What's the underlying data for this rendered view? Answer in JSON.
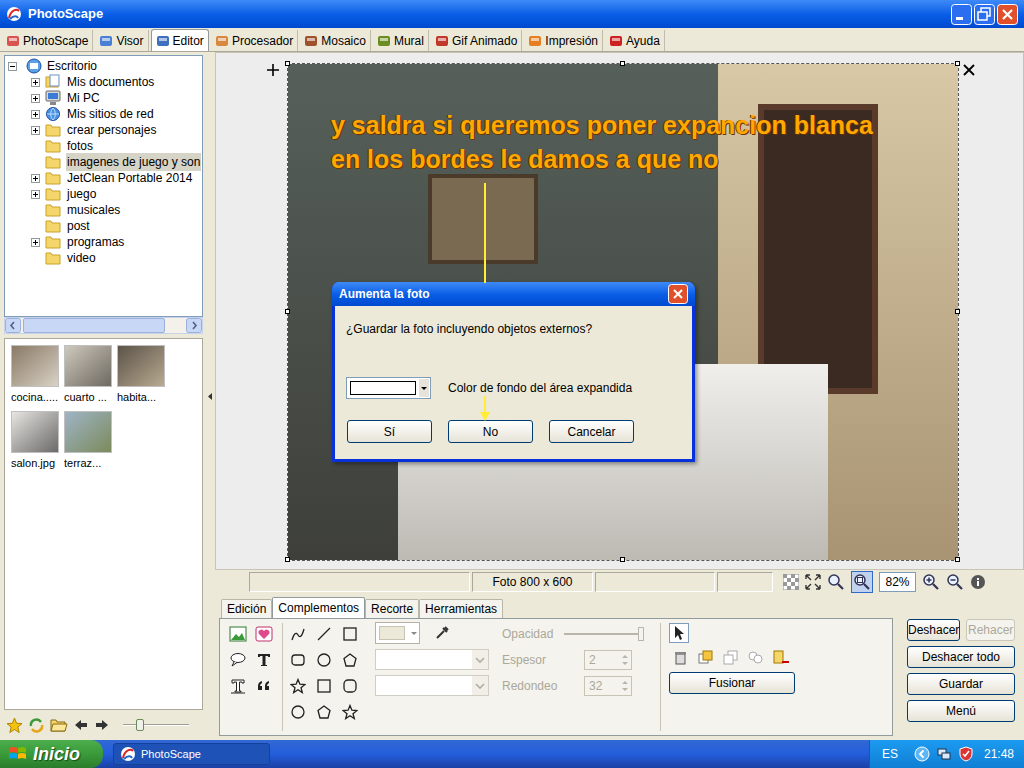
{
  "window": {
    "title": "PhotoScape"
  },
  "tabs": [
    {
      "label": "PhotoScape",
      "selected": false
    },
    {
      "label": "Visor",
      "selected": false
    },
    {
      "label": "Editor",
      "selected": true
    },
    {
      "label": "Procesador",
      "selected": false
    },
    {
      "label": "Mosaico",
      "selected": false
    },
    {
      "label": "Mural",
      "selected": false
    },
    {
      "label": "Gif Animado",
      "selected": false
    },
    {
      "label": "Impresión",
      "selected": false
    },
    {
      "label": "Ayuda",
      "selected": false
    }
  ],
  "tree": {
    "label": "Escritorio",
    "expanded": true,
    "children": [
      {
        "label": "Mis documentos",
        "expandable": true,
        "expanded": false,
        "selected": false
      },
      {
        "label": "Mi PC",
        "expandable": true,
        "expanded": false,
        "selected": false
      },
      {
        "label": "Mis sitios de red",
        "expandable": true,
        "expanded": false,
        "selected": false
      },
      {
        "label": "crear personajes",
        "expandable": true,
        "expanded": false,
        "selected": false
      },
      {
        "label": "fotos",
        "expandable": false,
        "expanded": false,
        "selected": false
      },
      {
        "label": "imagenes de juego y son",
        "expandable": false,
        "expanded": false,
        "selected": true
      },
      {
        "label": "JetClean Portable 2014",
        "expandable": true,
        "expanded": false,
        "selected": false
      },
      {
        "label": "juego",
        "expandable": true,
        "expanded": false,
        "selected": false
      },
      {
        "label": "musicales",
        "expandable": false,
        "expanded": false,
        "selected": false
      },
      {
        "label": "post",
        "expandable": false,
        "expanded": false,
        "selected": false
      },
      {
        "label": "programas",
        "expandable": true,
        "expanded": false,
        "selected": false
      },
      {
        "label": "video",
        "expandable": false,
        "expanded": false,
        "selected": false
      }
    ]
  },
  "thumbnails": [
    {
      "label": "cocina....."
    },
    {
      "label": "cuarto ..."
    },
    {
      "label": "habita..."
    },
    {
      "label": "salon.jpg"
    },
    {
      "label": "terraz..."
    }
  ],
  "thumbnail_size": {
    "level": 0.22
  },
  "canvas": {
    "annotation": [
      "y saldra si queremos poner expancion blanca",
      "en los bordes le damos a que no"
    ]
  },
  "dialog": {
    "title": "Aumenta la foto",
    "question": "¿Guardar la foto incluyendo objetos externos?",
    "color_label": "Color de fondo del área expandida",
    "color": "#ffffff",
    "buttons": [
      {
        "label": "Sí"
      },
      {
        "label": "No"
      },
      {
        "label": "Cancelar"
      }
    ]
  },
  "status_bar": {
    "photo_size": "Foto 800 x 600",
    "zoom": "82%"
  },
  "panel_tabs": [
    {
      "label": "Edición",
      "selected": false
    },
    {
      "label": "Complementos",
      "selected": true
    },
    {
      "label": "Recorte",
      "selected": false
    },
    {
      "label": "Herramientas",
      "selected": false
    }
  ],
  "properties": [
    {
      "label": "Opacidad",
      "kind": "slider",
      "level": 1,
      "disabled": true
    },
    {
      "label": "Espesor",
      "kind": "spin",
      "value": "2",
      "disabled": true
    },
    {
      "label": "Redondeo",
      "kind": "spin",
      "value": "32",
      "disabled": true
    }
  ],
  "merge_button": {
    "label": "Fusionar"
  },
  "actions": [
    {
      "label": "Deshacer",
      "disabled": false
    },
    {
      "label": "Rehacer",
      "disabled": true
    },
    {
      "label": "Deshacer todo",
      "disabled": false
    },
    {
      "label": "Guardar",
      "disabled": false
    },
    {
      "label": "Menú",
      "disabled": false
    }
  ],
  "taskbar": {
    "start": "Inicio",
    "task": "PhotoScape",
    "language": "ES",
    "clock": "21:48"
  }
}
